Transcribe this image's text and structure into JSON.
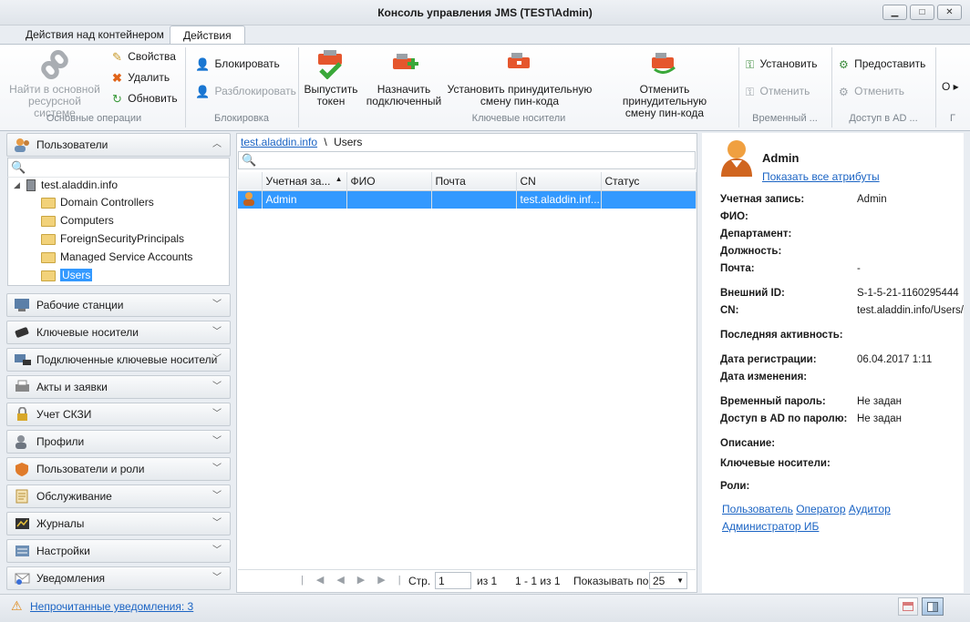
{
  "window": {
    "title": "Консоль управления JMS (TEST\\Admin)"
  },
  "tabs": [
    {
      "label": "Действия над контейнером"
    },
    {
      "label": "Действия"
    }
  ],
  "ribbon": {
    "basic": {
      "find": "Найти в основной ресурсной системе",
      "find_l1": "Найти в основной",
      "find_l2": "ресурсной системе",
      "props": "Свойства",
      "delete": "Удалить",
      "refresh": "Обновить",
      "label": "Основные операции"
    },
    "block": {
      "block": "Блокировать",
      "unblock": "Разблокировать",
      "label": "Блокировка"
    },
    "keys": {
      "issue_l1": "Выпустить",
      "issue_l2": "токен",
      "assign_l1": "Назначить",
      "assign_l2": "подключенный",
      "force_l1": "Установить принудительную",
      "force_l2": "смену пин-кода",
      "cancel_l1": "Отменить принудительную",
      "cancel_l2": "смену пин-кода",
      "label": "Ключевые носители"
    },
    "temp": {
      "set": "Установить",
      "cancel": "Отменить",
      "label": "Временный ..."
    },
    "ad": {
      "grant": "Предоставить",
      "cancel": "Отменить",
      "label": "Доступ в AD ..."
    },
    "more": {
      "label": "Г"
    }
  },
  "left": {
    "users_header": "Пользователи",
    "tree": {
      "root": "test.aladdin.info",
      "children": [
        "Domain Controllers",
        "Computers",
        "ForeignSecurityPrincipals",
        "Managed Service Accounts",
        "Users"
      ]
    },
    "panels": [
      "Рабочие станции",
      "Ключевые носители",
      "Подключенные ключевые носители",
      "Акты и заявки",
      "Учет СКЗИ",
      "Профили",
      "Пользователи и роли",
      "Обслуживание",
      "Журналы",
      "Настройки",
      "Уведомления"
    ]
  },
  "center": {
    "breadcrumb": {
      "link": "test.aladdin.info",
      "sep": "\\",
      "current": "Users"
    },
    "columns": [
      "Учетная за...",
      "ФИО",
      "Почта",
      "CN",
      "Статус"
    ],
    "rows": [
      {
        "account": "Admin",
        "fio": "",
        "mail": "",
        "cn": "test.aladdin.inf...",
        "status": ""
      }
    ],
    "pager": {
      "page_label": "Стр.",
      "page": "1",
      "of": "из 1",
      "range": "1 - 1 из 1",
      "show_label": "Показывать по",
      "per_page": "25"
    }
  },
  "details": {
    "name": "Admin",
    "show_all": "Показать все атрибуты",
    "fields": {
      "account_l": "Учетная запись:",
      "account_v": "Admin",
      "fio_l": "ФИО:",
      "dept_l": "Департамент:",
      "position_l": "Должность:",
      "mail_l": "Почта:",
      "mail_v": "-",
      "extid_l": "Внешний ID:",
      "extid_v": "S-1-5-21-1160295444",
      "cn_l": "CN:",
      "cn_v": "test.aladdin.info/Users/",
      "last_l": "Последняя активность:",
      "reg_l": "Дата регистрации:",
      "reg_v": "06.04.2017 1:11",
      "mod_l": "Дата изменения:",
      "temp_l": "Временный пароль:",
      "temp_v": "Не задан",
      "adpass_l": "Доступ в AD по паролю:",
      "adpass_v": "Не задан",
      "desc_l": "Описание:",
      "keys_l": "Ключевые носители:",
      "roles_l": "Роли:"
    },
    "roles": [
      "Пользователь",
      "Оператор",
      "Аудитор",
      "Администратор ИБ"
    ]
  },
  "status": {
    "notifications": "Непрочитанные уведомления: 3"
  },
  "colors": {
    "accent": "#3399ff",
    "link": "#1b64c4",
    "selection": "#3399ff"
  }
}
